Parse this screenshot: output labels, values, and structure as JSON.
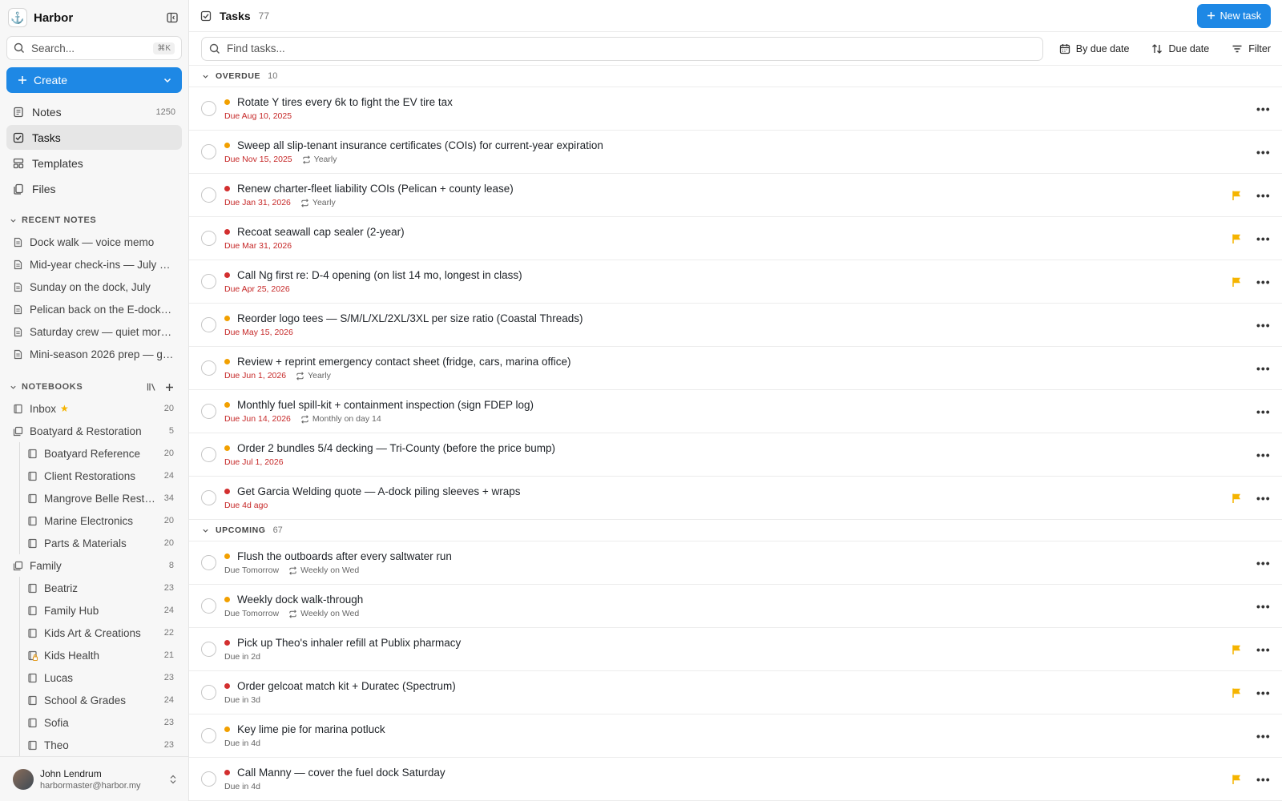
{
  "app": {
    "name": "Harbor"
  },
  "sidebar": {
    "search_placeholder": "Search...",
    "search_shortcut": "⌘K",
    "create_label": "Create",
    "nav": [
      {
        "label": "Notes",
        "count": "1250",
        "icon": "notes-icon"
      },
      {
        "label": "Tasks",
        "count": "",
        "icon": "tasks-icon"
      },
      {
        "label": "Templates",
        "count": "",
        "icon": "templates-icon"
      },
      {
        "label": "Files",
        "count": "",
        "icon": "files-icon"
      }
    ],
    "recent_header": "RECENT NOTES",
    "recent": [
      "Dock walk — voice memo",
      "Mid-year check-ins — July 2...",
      "Sunday on the dock, July",
      "Pelican back on the E-dock li...",
      "Saturday crew — quiet morni...",
      "Mini-season 2026 prep — ge..."
    ],
    "notebooks_header": "NOTEBOOKS",
    "inbox": {
      "label": "Inbox",
      "count": "20"
    },
    "stacks": [
      {
        "label": "Boatyard & Restoration",
        "count": "5",
        "children": [
          {
            "label": "Boatyard Reference",
            "count": "20"
          },
          {
            "label": "Client Restorations",
            "count": "24"
          },
          {
            "label": "Mangrove Belle Resto...",
            "count": "34"
          },
          {
            "label": "Marine Electronics",
            "count": "20"
          },
          {
            "label": "Parts & Materials",
            "count": "20"
          }
        ]
      },
      {
        "label": "Family",
        "count": "8",
        "children": [
          {
            "label": "Beatriz",
            "count": "23"
          },
          {
            "label": "Family Hub",
            "count": "24"
          },
          {
            "label": "Kids Art & Creations",
            "count": "22"
          },
          {
            "label": "Kids Health",
            "count": "21"
          },
          {
            "label": "Lucas",
            "count": "23"
          },
          {
            "label": "School & Grades",
            "count": "24"
          },
          {
            "label": "Sofia",
            "count": "23"
          },
          {
            "label": "Theo",
            "count": "23"
          }
        ]
      }
    ],
    "user": {
      "name": "John Lendrum",
      "email": "harbormaster@harbor.my"
    }
  },
  "main": {
    "title": "Tasks",
    "count": "77",
    "new_task_label": "New task",
    "find_placeholder": "Find tasks...",
    "group_by_label": "By due date",
    "sort_label": "Due date",
    "filter_label": "Filter",
    "colors": {
      "red": "#d32f2f",
      "orange": "#f2a000",
      "flag": "#f5b400",
      "accent": "#1e88e5"
    },
    "groups": [
      {
        "label": "OVERDUE",
        "count": "10",
        "tasks": [
          {
            "title": "Rotate Y tires every 6k to fight the EV tire tax",
            "due": "Due Aug 10, 2025",
            "recur": "",
            "priority": "orange",
            "flag": false,
            "overdue": true
          },
          {
            "title": "Sweep all slip-tenant insurance certificates (COIs) for current-year expiration",
            "due": "Due Nov 15, 2025",
            "recur": "Yearly",
            "priority": "orange",
            "flag": false,
            "overdue": true
          },
          {
            "title": "Renew charter-fleet liability COIs (Pelican + county lease)",
            "due": "Due Jan 31, 2026",
            "recur": "Yearly",
            "priority": "red",
            "flag": true,
            "overdue": true
          },
          {
            "title": "Recoat seawall cap sealer (2-year)",
            "due": "Due Mar 31, 2026",
            "recur": "",
            "priority": "red",
            "flag": true,
            "overdue": true
          },
          {
            "title": "Call Ng first re: D-4 opening (on list 14 mo, longest in class)",
            "due": "Due Apr 25, 2026",
            "recur": "",
            "priority": "red",
            "flag": true,
            "overdue": true
          },
          {
            "title": "Reorder logo tees — S/M/L/XL/2XL/3XL per size ratio (Coastal Threads)",
            "due": "Due May 15, 2026",
            "recur": "",
            "priority": "orange",
            "flag": false,
            "overdue": true
          },
          {
            "title": "Review + reprint emergency contact sheet (fridge, cars, marina office)",
            "due": "Due Jun 1, 2026",
            "recur": "Yearly",
            "priority": "orange",
            "flag": false,
            "overdue": true
          },
          {
            "title": "Monthly fuel spill-kit + containment inspection (sign FDEP log)",
            "due": "Due Jun 14, 2026",
            "recur": "Monthly on day 14",
            "priority": "orange",
            "flag": false,
            "overdue": true
          },
          {
            "title": "Order 2 bundles 5/4 decking — Tri-County (before the price bump)",
            "due": "Due Jul 1, 2026",
            "recur": "",
            "priority": "orange",
            "flag": false,
            "overdue": true
          },
          {
            "title": "Get Garcia Welding quote — A-dock piling sleeves + wraps",
            "due": "Due 4d ago",
            "recur": "",
            "priority": "red",
            "flag": true,
            "overdue": true
          }
        ]
      },
      {
        "label": "UPCOMING",
        "count": "67",
        "tasks": [
          {
            "title": "Flush the outboards after every saltwater run",
            "due": "Due Tomorrow",
            "recur": "Weekly on Wed",
            "priority": "orange",
            "flag": false,
            "overdue": false
          },
          {
            "title": "Weekly dock walk-through",
            "due": "Due Tomorrow",
            "recur": "Weekly on Wed",
            "priority": "orange",
            "flag": false,
            "overdue": false
          },
          {
            "title": "Pick up Theo's inhaler refill at Publix pharmacy",
            "due": "Due in 2d",
            "recur": "",
            "priority": "red",
            "flag": true,
            "overdue": false
          },
          {
            "title": "Order gelcoat match kit + Duratec (Spectrum)",
            "due": "Due in 3d",
            "recur": "",
            "priority": "red",
            "flag": true,
            "overdue": false
          },
          {
            "title": "Key lime pie for marina potluck",
            "due": "Due in 4d",
            "recur": "",
            "priority": "orange",
            "flag": false,
            "overdue": false
          },
          {
            "title": "Call Manny — cover the fuel dock Saturday",
            "due": "Due in 4d",
            "recur": "",
            "priority": "red",
            "flag": true,
            "overdue": false
          }
        ]
      }
    ]
  }
}
